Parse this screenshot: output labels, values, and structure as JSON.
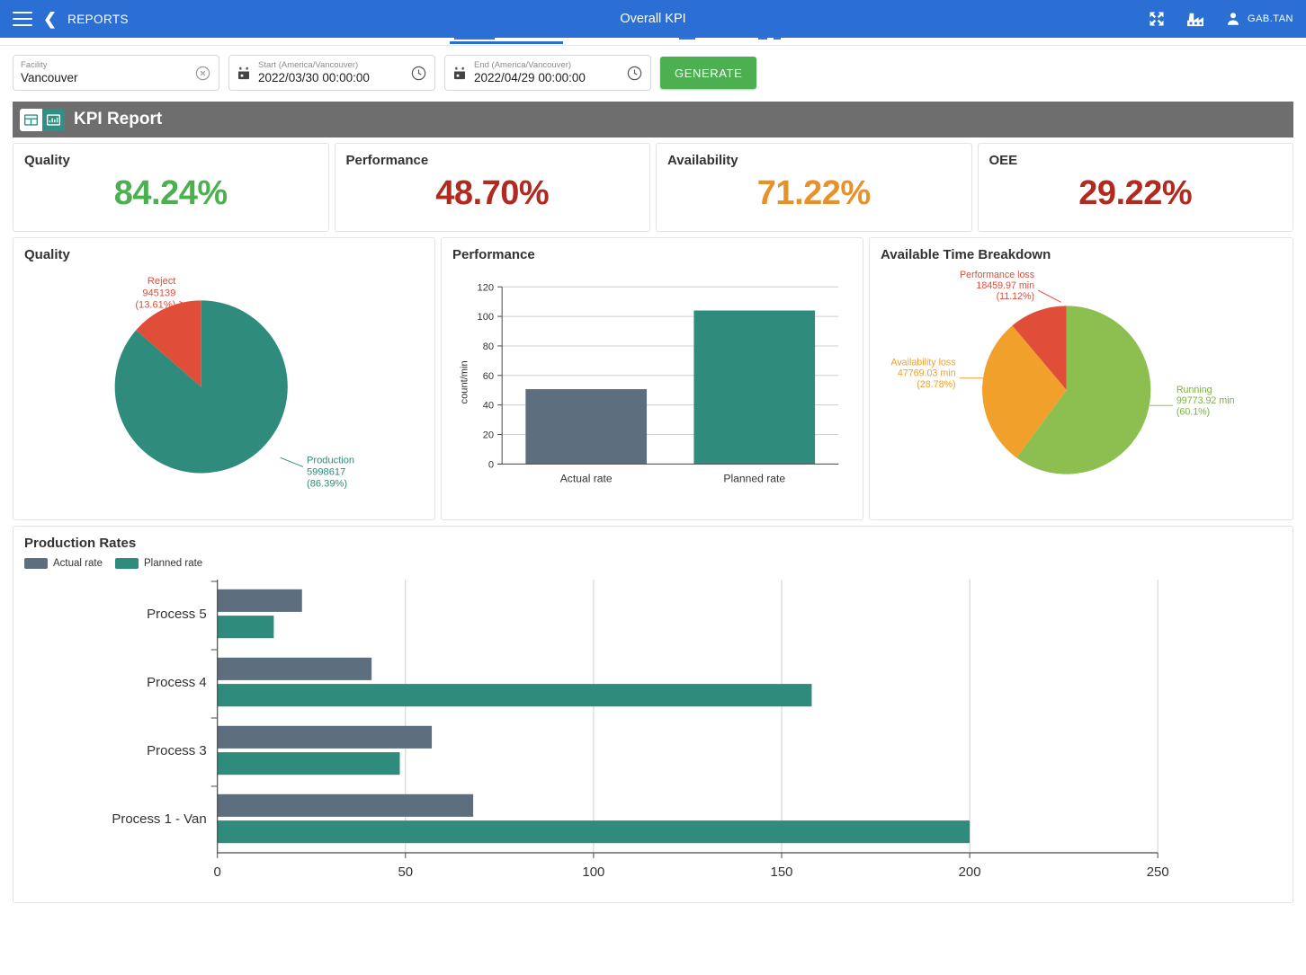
{
  "appbar": {
    "menu_icon": "hamburger-icon",
    "back_icon": "chevron-left-icon",
    "back_label": "REPORTS",
    "title": "Overall KPI",
    "fullscreen_icon": "fullscreen-expand-icon",
    "factory_icon": "factory-icon",
    "user_icon": "person-icon",
    "user_name": "GAB.TAN",
    "accent_color": "#2b6fd4"
  },
  "filters": {
    "facility": {
      "label": "Facility",
      "value": "Vancouver",
      "clear_icon": "clear-circle-icon"
    },
    "start": {
      "label": "Start (America/Vancouver)",
      "value": "2022/03/30 00:00:00",
      "calendar_icon": "calendar-icon",
      "clock_icon": "clock-icon"
    },
    "end": {
      "label": "End (America/Vancouver)",
      "value": "2022/04/29 00:00:00",
      "calendar_icon": "calendar-icon",
      "clock_icon": "clock-icon"
    },
    "generate_label": "GENERATE",
    "generate_color": "#4caf50"
  },
  "report": {
    "title": "KPI Report",
    "table_view_icon": "table-view-icon",
    "chart_view_icon": "chart-view-icon",
    "header_color": "#6e6e6e"
  },
  "kpis": [
    {
      "label": "Quality",
      "value": "84.24%",
      "color": "#4caf50"
    },
    {
      "label": "Performance",
      "value": "48.70%",
      "color": "#b02a20"
    },
    {
      "label": "Availability",
      "value": "71.22%",
      "color": "#e8912a"
    },
    {
      "label": "OEE",
      "value": "29.22%",
      "color": "#b02a20"
    }
  ],
  "panels": {
    "quality_title": "Quality",
    "performance_title": "Performance",
    "breakdown_title": "Available Time Breakdown",
    "production_title": "Production Rates"
  },
  "legend": [
    {
      "label": "Actual rate",
      "color": "#5d6e7e"
    },
    {
      "label": "Planned rate",
      "color": "#2f8b7c"
    }
  ],
  "chart_data": [
    {
      "type": "pie",
      "title": "Quality",
      "slices": [
        {
          "name": "Production",
          "value": 5998617,
          "percent": 86.39,
          "label": "Production\n5998617\n(86.39%)",
          "color": "#2f8b7c"
        },
        {
          "name": "Reject",
          "value": 945139,
          "percent": 13.61,
          "label": "Reject\n945139\n(13.61%)",
          "color": "#e04e39"
        }
      ],
      "legend": "labels-outside"
    },
    {
      "type": "bar",
      "title": "Performance",
      "categories": [
        "Actual rate",
        "Planned rate"
      ],
      "values": [
        50.7,
        104
      ],
      "colors": [
        "#5d6e7e",
        "#2f8b7c"
      ],
      "xlabel": "",
      "ylabel": "count/min",
      "ylim": [
        0,
        120
      ],
      "yticks": [
        0,
        20,
        40,
        60,
        80,
        100,
        120
      ],
      "grid": true
    },
    {
      "type": "pie",
      "title": "Available Time Breakdown",
      "slices": [
        {
          "name": "Running",
          "value": 99773.92,
          "percent": 60.1,
          "unit": "min",
          "label": "Running\n99773.92 min\n(60.1%)",
          "color": "#8cbf4f"
        },
        {
          "name": "Availability loss",
          "value": 47769.03,
          "percent": 28.78,
          "unit": "min",
          "label": "Availability loss\n47769.03 min\n(28.78%)",
          "color": "#f2a02c"
        },
        {
          "name": "Performance loss",
          "value": 18459.97,
          "percent": 11.12,
          "unit": "min",
          "label": "Performance loss\n18459.97 min\n(11.12%)",
          "color": "#e04e39"
        }
      ],
      "legend": "labels-outside"
    },
    {
      "type": "bar",
      "orientation": "horizontal",
      "title": "Production Rates",
      "categories": [
        "Process 1 - Van",
        "Process 3",
        "Process 4",
        "Process 5"
      ],
      "series": [
        {
          "name": "Actual rate",
          "color": "#5d6e7e",
          "values": [
            68,
            57,
            41,
            22.5
          ]
        },
        {
          "name": "Planned rate",
          "color": "#2f8b7c",
          "values": [
            200,
            48.5,
            158,
            15
          ]
        }
      ],
      "xlim": [
        0,
        250
      ],
      "xticks": [
        0,
        50,
        100,
        150,
        200,
        250
      ],
      "ylabel": "",
      "xlabel": "",
      "grid": true
    }
  ]
}
